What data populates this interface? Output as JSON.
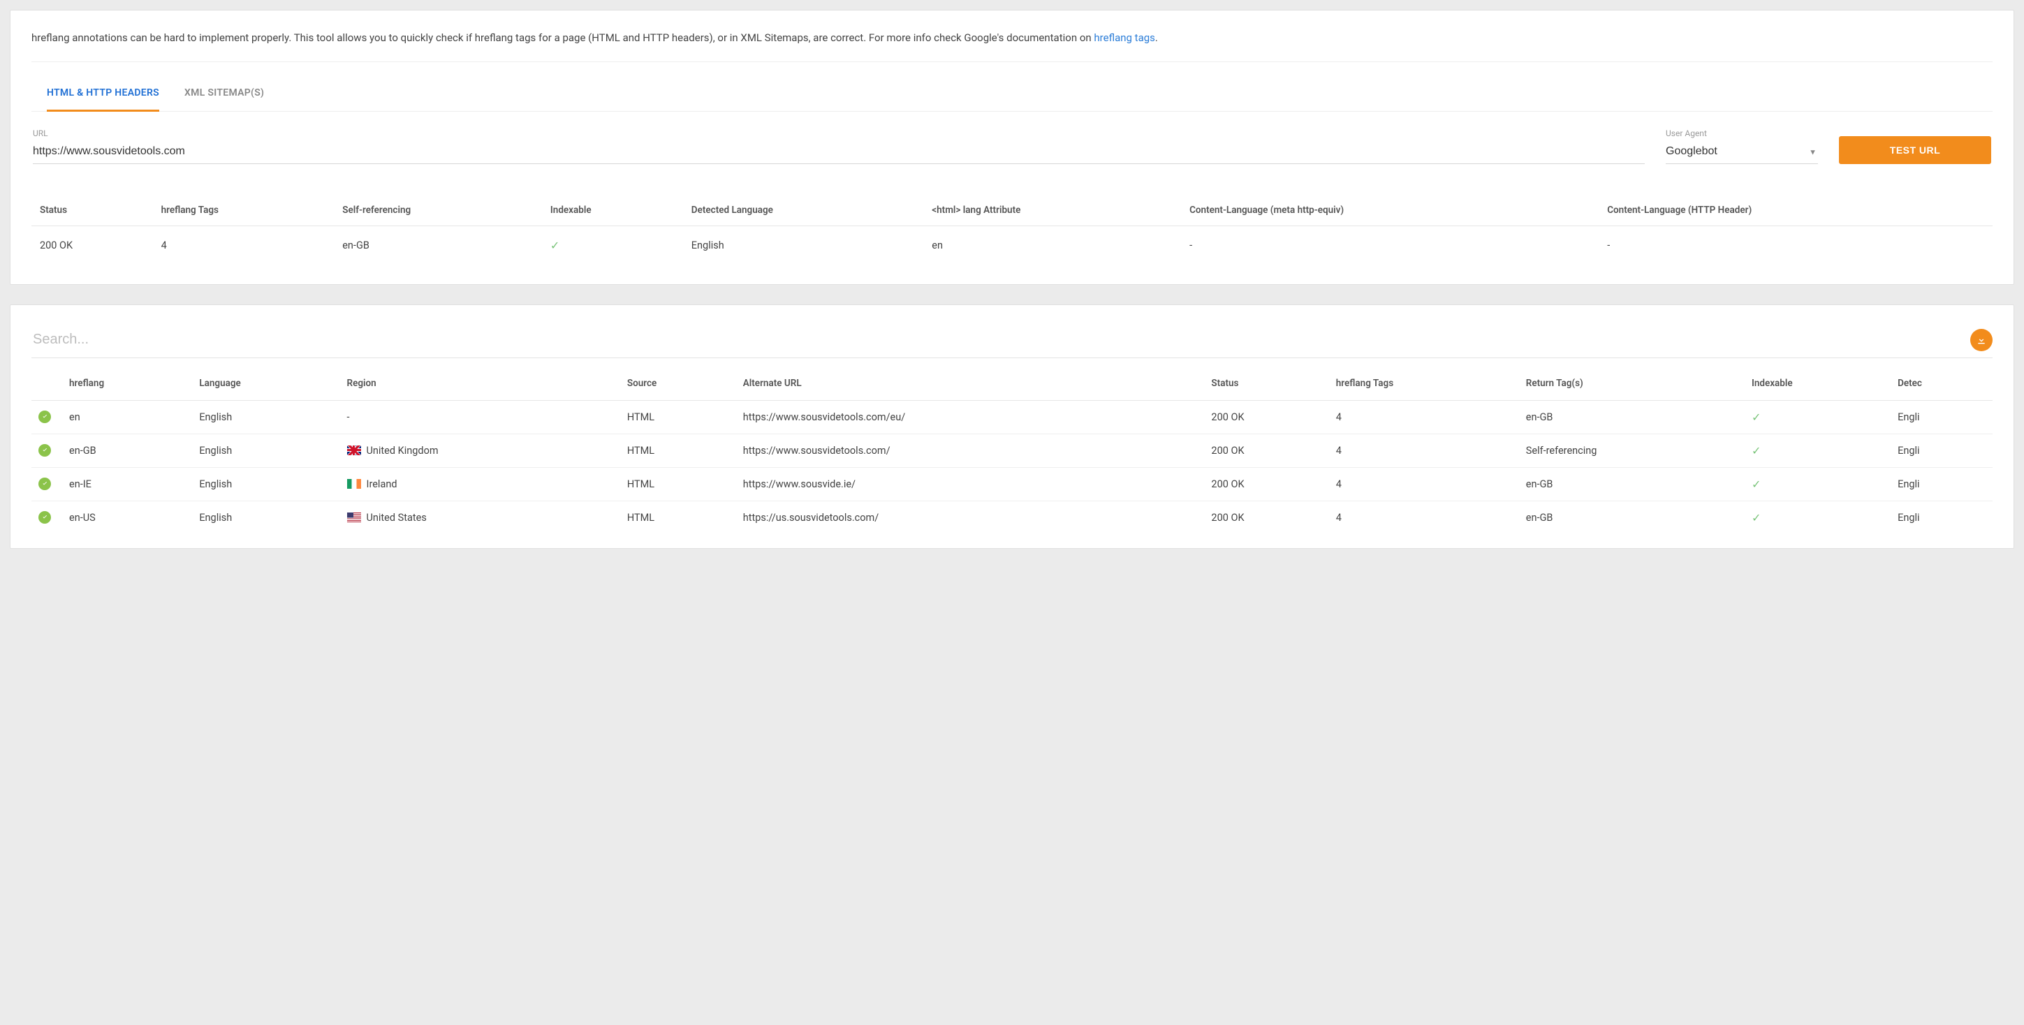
{
  "intro": {
    "text_before": "hreflang annotations can be hard to implement properly. This tool allows you to quickly check if hreflang tags for a page (HTML and HTTP headers), or in XML Sitemaps, are correct. For more info check Google's documentation on ",
    "link_text": "hreflang tags",
    "text_after": "."
  },
  "tabs": {
    "active": "HTML & HTTP HEADERS",
    "other": "XML SITEMAP(S)"
  },
  "form": {
    "url_label": "URL",
    "url_value": "https://www.sousvidetools.com",
    "agent_label": "User Agent",
    "agent_value": "Googlebot",
    "button": "TEST URL"
  },
  "summary": {
    "headers": {
      "status": "Status",
      "tags": "hreflang Tags",
      "selfref": "Self-referencing",
      "indexable": "Indexable",
      "detlang": "Detected Language",
      "htmllang": "<html> lang Attribute",
      "metacl": "Content-Language (meta http-equiv)",
      "httpcl": "Content-Language (HTTP Header)"
    },
    "row": {
      "status": "200 OK",
      "tags": "4",
      "selfref": "en-GB",
      "indexable_ok": true,
      "detlang": "English",
      "htmllang": "en",
      "metacl": "-",
      "httpcl": "-"
    }
  },
  "search": {
    "placeholder": "Search..."
  },
  "results": {
    "headers": {
      "hreflang": "hreflang",
      "language": "Language",
      "region": "Region",
      "source": "Source",
      "alturl": "Alternate URL",
      "status": "Status",
      "tags": "hreflang Tags",
      "returntags": "Return Tag(s)",
      "indexable": "Indexable",
      "detected": "Detec"
    },
    "rows": [
      {
        "ok": true,
        "hreflang": "en",
        "language": "English",
        "region_flag": "",
        "region": "-",
        "source": "HTML",
        "alturl": "https://www.sousvidetools.com/eu/",
        "status": "200 OK",
        "tags": "4",
        "returntags": "en-GB",
        "indexable_ok": true,
        "detected": "Engli"
      },
      {
        "ok": true,
        "hreflang": "en-GB",
        "language": "English",
        "region_flag": "gb",
        "region": "United Kingdom",
        "source": "HTML",
        "alturl": "https://www.sousvidetools.com/",
        "status": "200 OK",
        "tags": "4",
        "returntags": "Self-referencing",
        "indexable_ok": true,
        "detected": "Engli"
      },
      {
        "ok": true,
        "hreflang": "en-IE",
        "language": "English",
        "region_flag": "ie",
        "region": "Ireland",
        "source": "HTML",
        "alturl": "https://www.sousvide.ie/",
        "status": "200 OK",
        "tags": "4",
        "returntags": "en-GB",
        "indexable_ok": true,
        "detected": "Engli"
      },
      {
        "ok": true,
        "hreflang": "en-US",
        "language": "English",
        "region_flag": "us",
        "region": "United States",
        "source": "HTML",
        "alturl": "https://us.sousvidetools.com/",
        "status": "200 OK",
        "tags": "4",
        "returntags": "en-GB",
        "indexable_ok": true,
        "detected": "Engli"
      }
    ]
  }
}
